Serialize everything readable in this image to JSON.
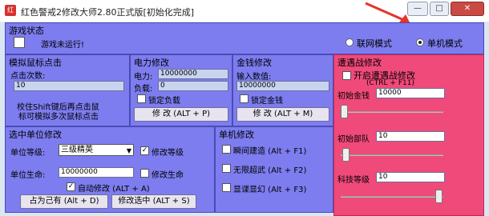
{
  "window": {
    "icon_glyph": "红",
    "title": "红色警戒2修改大师2.80正式版[初始化完成]",
    "buttons": {
      "minimize": "—",
      "maximize": "□",
      "close": "✕"
    }
  },
  "game_status": {
    "title": "游戏状态",
    "status_text": "游戏未运行!",
    "modes": [
      {
        "label": "联网模式",
        "selected": false
      },
      {
        "label": "单机模式",
        "selected": true
      }
    ]
  },
  "mouse_sim": {
    "title": "模拟鼠标点击",
    "clicks_label": "点击次数:",
    "clicks_value": "10",
    "hint_line1": "校住Shift键后再点击鼠",
    "hint_line2": "标可模拟多次鼠标点击"
  },
  "power": {
    "title": "电力修改",
    "power_label": "电力:",
    "power_value": "10000000",
    "load_label": "负载:",
    "load_value": "0",
    "lock_label": "锁定负载",
    "button": "修 改 (ALT + P)"
  },
  "money": {
    "title": "金钱修改",
    "input_label": "输入数值:",
    "input_value": "10000000",
    "lock_label": "锁定金钱",
    "button": "修 改 (ALT + M)"
  },
  "encounter": {
    "title": "遭遇战修改",
    "enable_label": "开启遭遇战修改",
    "shortcut": "(CTRL + F11)",
    "initial_money_label": "初始金钱",
    "initial_money_value": "10000",
    "initial_units_label": "初始部队",
    "initial_units_value": "10",
    "tech_level_label": "科技等级",
    "tech_level_value": "10"
  },
  "select_unit": {
    "title": "选中单位修改",
    "level_label": "单位等级:",
    "level_value": "三级精英",
    "modify_level_label": "修改等级",
    "modify_level_checked": true,
    "life_label": "单位生命:",
    "life_value": "10000000",
    "modify_life_label": "修改生命",
    "modify_life_checked": false,
    "auto_label": "自动修改 (ALT + A)",
    "auto_checked": true,
    "take_button": "占为己有 (Alt + D)",
    "modify_button": "修改选中 (ALT + S)"
  },
  "single": {
    "title": "单机修改",
    "items": [
      {
        "label": "瞬间建造 (Alt + F1)",
        "checked": false
      },
      {
        "label": "无限超武 (Alt + F2)",
        "checked": false
      },
      {
        "label": "显谍显幻 (Alt + F3)",
        "checked": false
      }
    ]
  }
}
